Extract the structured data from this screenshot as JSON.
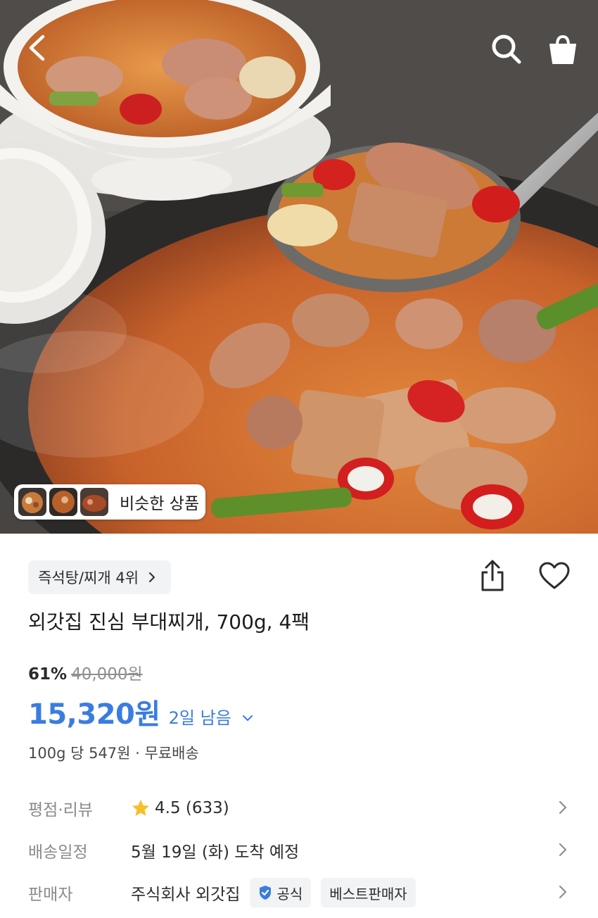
{
  "header": {
    "back_icon": "chevron-left-icon",
    "search_icon": "search-icon",
    "cart_icon": "shopping-bag-icon"
  },
  "similar": {
    "label": "비슷한 상품"
  },
  "rank": {
    "label": "즉석탕/찌개 4위"
  },
  "product": {
    "title": "외갓집 진심 부대찌개, 700g, 4팩",
    "discount_rate": "61%",
    "original_price": "40,000원",
    "sale_price": "15,320원",
    "remaining": "2일 남음",
    "unit_info": "100g 당 547원 · 무료배송"
  },
  "specs": {
    "rating_label": "평점·리뷰",
    "rating_value": "4.5 (633)",
    "delivery_label": "배송일정",
    "delivery_value": "5월 19일 (화) 도착 예정",
    "seller_label": "판매자",
    "seller_value": "주식회사 외갓집",
    "official_badge": "공식",
    "best_seller_badge": "베스트판매자"
  },
  "colors": {
    "accent_blue": "#3a7de0",
    "star_yellow": "#f5c02a",
    "chip_bg": "#f2f3f5"
  }
}
